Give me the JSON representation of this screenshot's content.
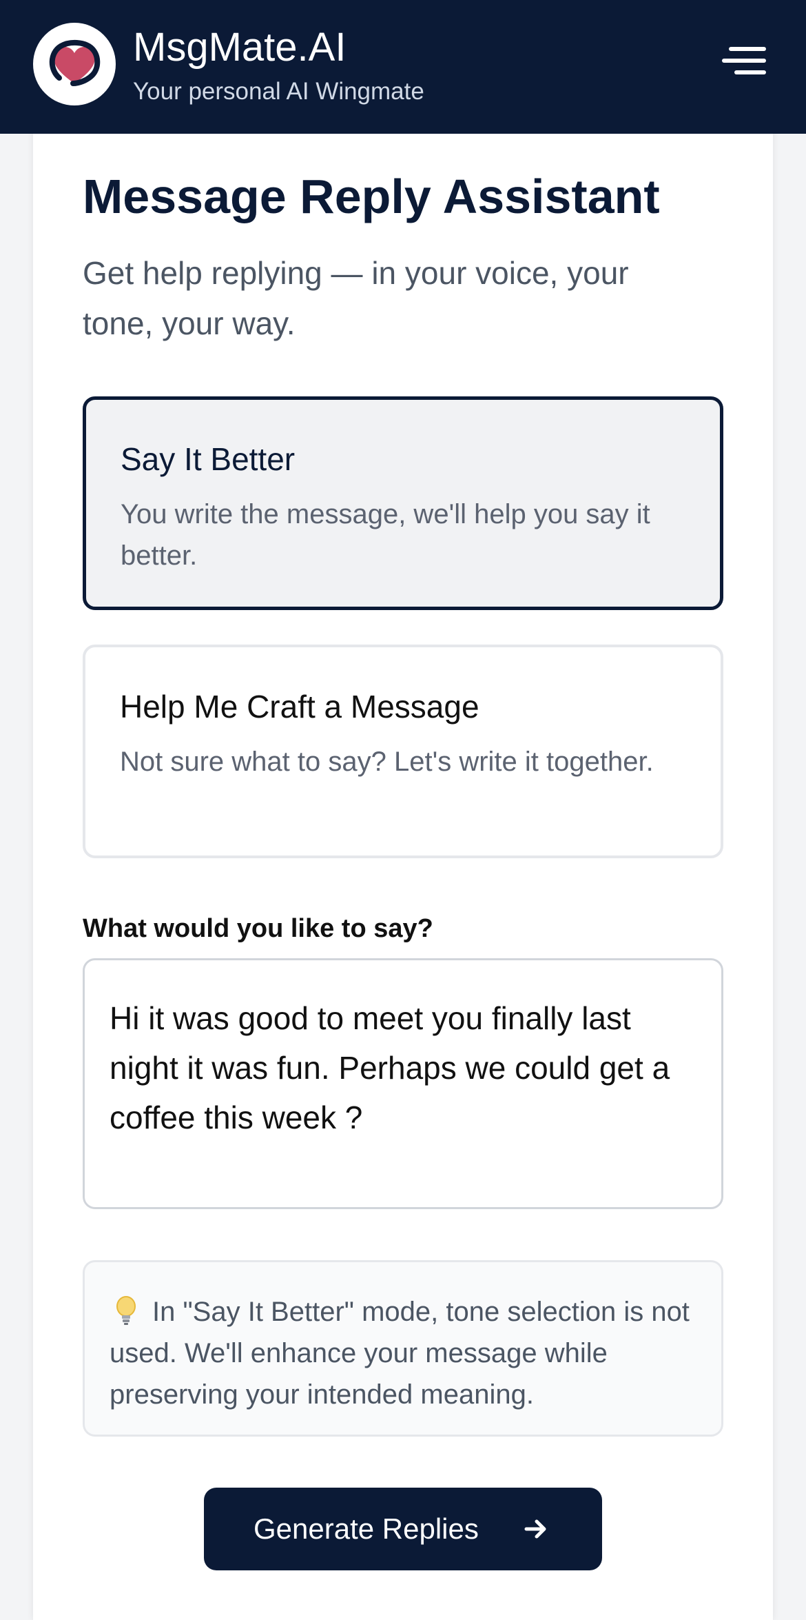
{
  "header": {
    "brand_name": "MsgMate.AI",
    "tagline": "Your personal AI Wingmate",
    "logo_icon": "heart-chat-icon",
    "menu_icon": "hamburger-menu-icon",
    "background_color": "#0b1a36",
    "logo_heart_color": "#c94a66"
  },
  "main": {
    "title": "Message Reply Assistant",
    "subtitle": "Get help replying — in your voice, your tone, your way."
  },
  "modes": [
    {
      "title": "Say It Better",
      "description": "You write the message, we'll help you say it better.",
      "selected": true
    },
    {
      "title": "Help Me Craft a Message",
      "description": "Not sure what to say? Let's write it together.",
      "selected": false
    }
  ],
  "message_field": {
    "label": "What would you like to say?",
    "value": "Hi it was good to meet you finally last night it was fun. Perhaps we could get a coffee this week ?"
  },
  "tip": {
    "icon": "lightbulb-icon",
    "text": "In \"Say It Better\" mode, tone selection is not used. We'll enhance your message while preserving your intended meaning."
  },
  "actions": {
    "generate_label": "Generate Replies",
    "generate_icon": "arrow-right-icon"
  }
}
